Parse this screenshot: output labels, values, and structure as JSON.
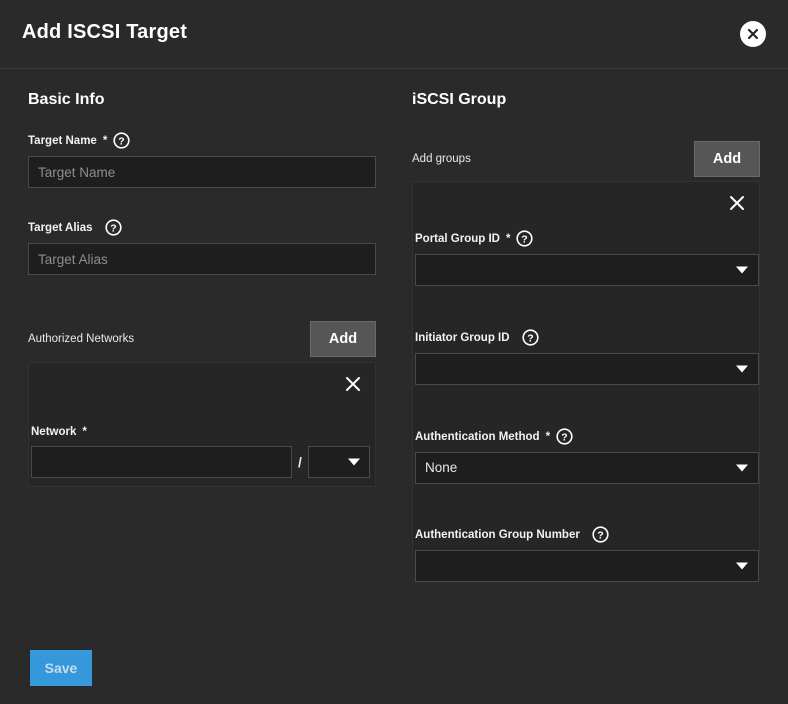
{
  "header": {
    "title": "Add ISCSI Target",
    "close_icon": "close-icon"
  },
  "basic_info": {
    "section_title": "Basic Info",
    "target_name": {
      "label": "Target Name",
      "required_marker": "*",
      "help_icon": "help-circle-icon",
      "placeholder": "Target Name",
      "value": ""
    },
    "target_alias": {
      "label": "Target Alias",
      "required_marker": "",
      "help_icon": "help-circle-icon",
      "placeholder": "Target Alias",
      "value": ""
    },
    "authorized_networks": {
      "label": "Authorized Networks",
      "add_label": "Add",
      "entry": {
        "remove_icon": "close-x-icon",
        "network": {
          "label": "Network",
          "required_marker": "*",
          "placeholder": "",
          "value": ""
        },
        "separator": "/",
        "netmask": {
          "value": "",
          "caret_icon": "chevron-down-icon"
        }
      }
    }
  },
  "iscsi_group": {
    "section_title": "iSCSI Group",
    "add_groups": {
      "label": "Add groups",
      "add_label": "Add"
    },
    "entry": {
      "remove_icon": "close-x-icon",
      "portal_group_id": {
        "label": "Portal Group ID",
        "required_marker": "*",
        "help_icon": "help-circle-icon",
        "value": "",
        "caret_icon": "chevron-down-icon"
      },
      "initiator_group_id": {
        "label": "Initiator Group ID",
        "required_marker": "",
        "help_icon": "help-circle-icon",
        "value": "",
        "caret_icon": "chevron-down-icon"
      },
      "authentication_method": {
        "label": "Authentication Method",
        "required_marker": "*",
        "help_icon": "help-circle-icon",
        "value": "None",
        "caret_icon": "chevron-down-icon"
      },
      "authentication_group_number": {
        "label": "Authentication Group Number",
        "required_marker": "",
        "help_icon": "help-circle-icon",
        "value": "",
        "caret_icon": "chevron-down-icon"
      }
    }
  },
  "footer": {
    "save_label": "Save"
  },
  "colors": {
    "page_background": "#2a2a2a",
    "panel_background": "#262626",
    "input_background": "#1e1e1e",
    "input_border": "#4a4a4a",
    "add_button": "#565656",
    "save_button": "#3498db",
    "save_button_text": "#c9dced",
    "text_primary": "#ffffff",
    "placeholder_text": "#8d8d8d"
  }
}
